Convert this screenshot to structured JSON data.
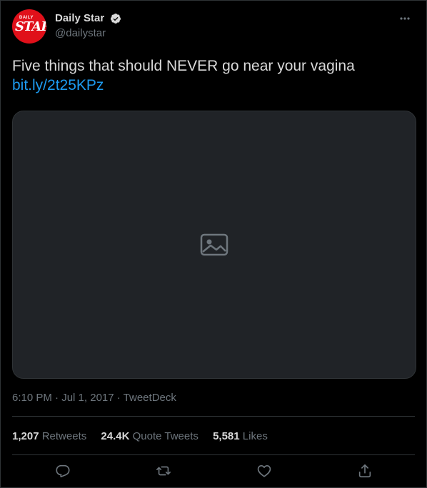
{
  "account": {
    "display_name": "Daily Star",
    "handle": "@dailystar",
    "logo_small": "DAILY",
    "logo_big": "STAR",
    "verified": true
  },
  "tweet": {
    "text": "Five things that should NEVER go near your vagina",
    "link": "bit.ly/2t25KPz"
  },
  "media": {
    "kind": "photo"
  },
  "meta": {
    "time": "6:10 PM",
    "sep1": " · ",
    "date": "Jul 1, 2017",
    "sep2": " · ",
    "client": "TweetDeck"
  },
  "stats": {
    "retweets_count": "1,207",
    "retweets_label": "Retweets",
    "quotes_count": "24.4K",
    "quotes_label": "Quote Tweets",
    "likes_count": "5,581",
    "likes_label": "Likes"
  },
  "icons": {
    "more": "more-horizontal-icon",
    "reply": "reply-icon",
    "retweet": "retweet-icon",
    "like": "like-icon",
    "share": "share-icon",
    "verified": "verified-badge-icon"
  },
  "colors": {
    "background": "#000000",
    "text": "#d9d9d9",
    "muted": "#6e767d",
    "link": "#1d9bf0",
    "brand": "#e0101a"
  }
}
